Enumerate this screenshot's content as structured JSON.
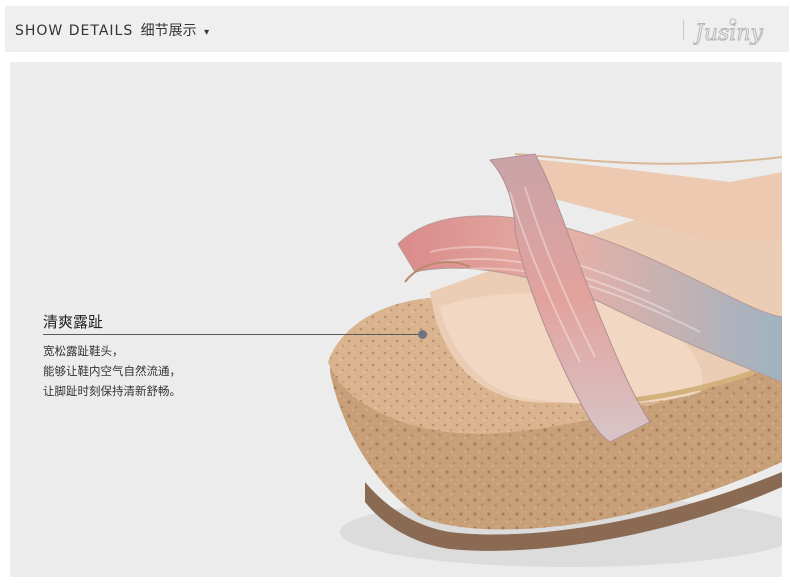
{
  "header": {
    "title_en": "SHOW DETAILS",
    "title_zh": "细节展示",
    "arrow": "▾",
    "brand": "Jusiny"
  },
  "callout": {
    "title": "清爽露趾",
    "lines": [
      "宽松露趾鞋头，",
      "能够让鞋内空气自然流通，",
      "让脚趾时刻保持清新舒畅。"
    ]
  },
  "colors": {
    "header_bg": "#efefef",
    "photo_bg": "#ececec",
    "cork": "#c59b70",
    "strap_pink": "#d98a8a",
    "strap_blue": "#8fa7b8",
    "insole": "#e8c8b0",
    "accent_dot": "#6b7384"
  }
}
